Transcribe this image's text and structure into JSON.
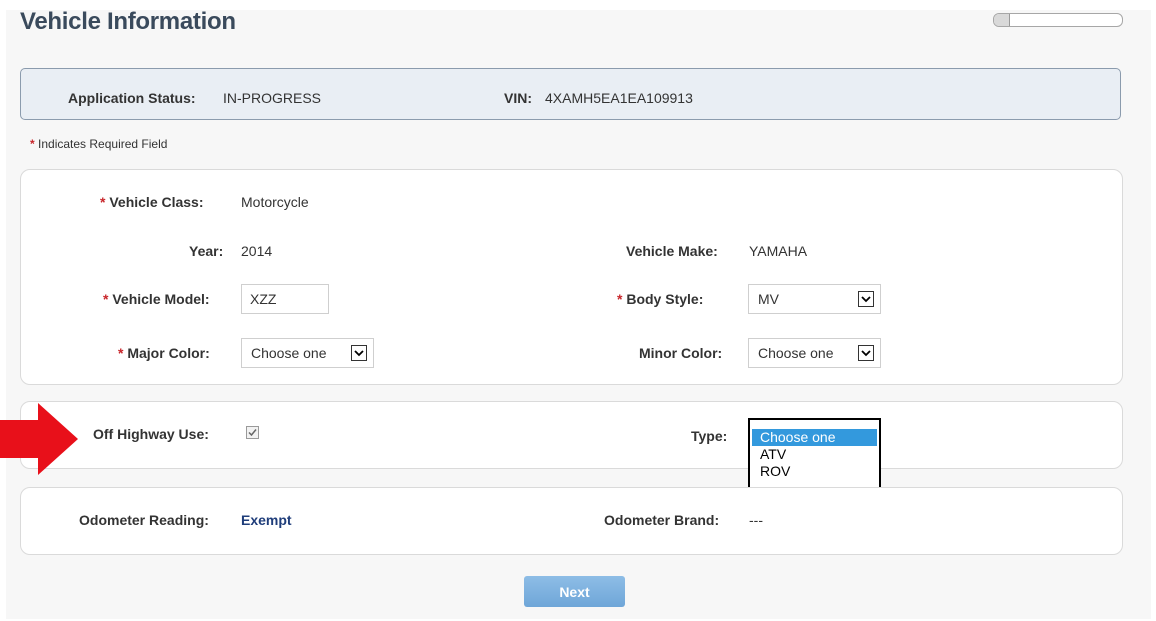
{
  "title": "Vehicle Information",
  "progress": {
    "fraction": 0.12
  },
  "status_bar": {
    "status_label": "Application Status:",
    "status_value": "IN-PROGRESS",
    "vin_label": "VIN:",
    "vin_value": "4XAMH5EA1EA109913"
  },
  "required_note": {
    "star": "*",
    "text": "Indicates Required Field"
  },
  "vehicle": {
    "class_label": "Vehicle Class:",
    "class_value": "Motorcycle",
    "year_label": "Year:",
    "year_value": "2014",
    "make_label": "Vehicle Make:",
    "make_value": "YAMAHA",
    "model_label": "Vehicle Model:",
    "model_value": "XZZ",
    "body_style_label": "Body Style:",
    "body_style_value": "MV",
    "major_color_label": "Major Color:",
    "major_color_value": "Choose one",
    "minor_color_label": "Minor Color:",
    "minor_color_value": "Choose one"
  },
  "off_highway": {
    "label": "Off Highway Use:",
    "checked": true,
    "type_label": "Type:",
    "type_options": [
      "Choose one",
      "ATV",
      "ROV"
    ],
    "type_selected": "Choose one"
  },
  "odometer": {
    "reading_label": "Odometer Reading:",
    "reading_value": "Exempt",
    "brand_label": "Odometer Brand:",
    "brand_value": "---"
  },
  "next_button": "Next",
  "colors": {
    "title": "#3a4a5c",
    "required_star": "#c8262b",
    "link": "#1f3d7a",
    "listbox_selected": "#3399dd",
    "pointer_arrow": "#e8101a",
    "next_button": "#7fb2e0"
  }
}
